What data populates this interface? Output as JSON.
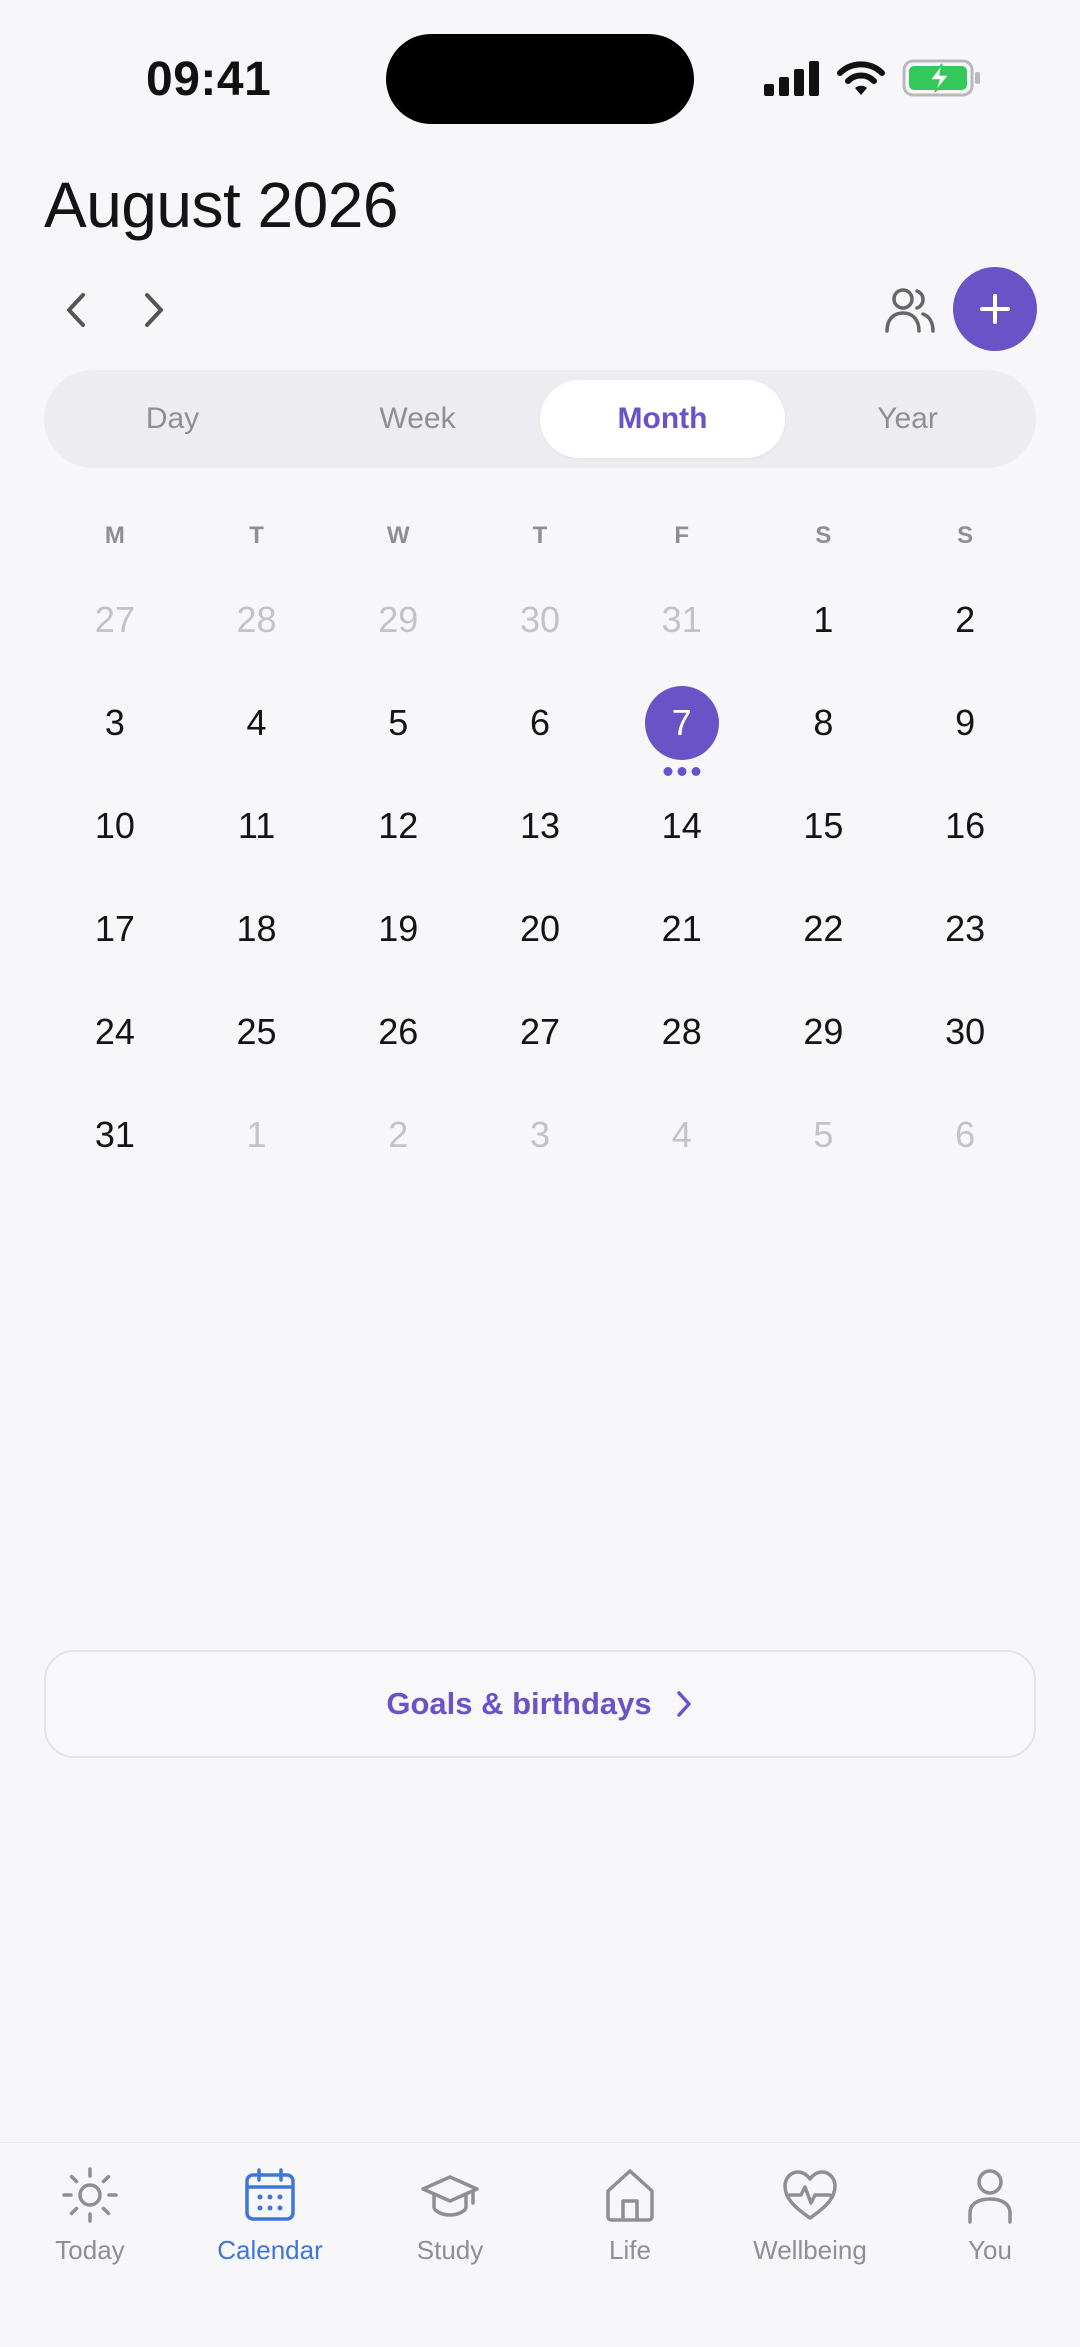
{
  "status_bar": {
    "time": "09:41"
  },
  "header": {
    "title": "August 2026"
  },
  "icons": {
    "prev": "chevron-left-icon",
    "next": "chevron-right-icon",
    "people": "people-icon",
    "add": "plus-icon"
  },
  "view_tabs": [
    {
      "label": "Day",
      "active": false
    },
    {
      "label": "Week",
      "active": false
    },
    {
      "label": "Month",
      "active": true
    },
    {
      "label": "Year",
      "active": false
    }
  ],
  "weekdays": [
    "M",
    "T",
    "W",
    "T",
    "F",
    "S",
    "S"
  ],
  "days": [
    {
      "n": "27",
      "muted": true
    },
    {
      "n": "28",
      "muted": true
    },
    {
      "n": "29",
      "muted": true
    },
    {
      "n": "30",
      "muted": true
    },
    {
      "n": "31",
      "muted": true
    },
    {
      "n": "1"
    },
    {
      "n": "2"
    },
    {
      "n": "3"
    },
    {
      "n": "4"
    },
    {
      "n": "5"
    },
    {
      "n": "6"
    },
    {
      "n": "7",
      "today": true,
      "events": 3
    },
    {
      "n": "8"
    },
    {
      "n": "9"
    },
    {
      "n": "10"
    },
    {
      "n": "11"
    },
    {
      "n": "12"
    },
    {
      "n": "13"
    },
    {
      "n": "14"
    },
    {
      "n": "15"
    },
    {
      "n": "16"
    },
    {
      "n": "17"
    },
    {
      "n": "18"
    },
    {
      "n": "19"
    },
    {
      "n": "20"
    },
    {
      "n": "21"
    },
    {
      "n": "22"
    },
    {
      "n": "23"
    },
    {
      "n": "24"
    },
    {
      "n": "25"
    },
    {
      "n": "26"
    },
    {
      "n": "27"
    },
    {
      "n": "28"
    },
    {
      "n": "29"
    },
    {
      "n": "30"
    },
    {
      "n": "31"
    },
    {
      "n": "1",
      "muted": true
    },
    {
      "n": "2",
      "muted": true
    },
    {
      "n": "3",
      "muted": true
    },
    {
      "n": "4",
      "muted": true
    },
    {
      "n": "5",
      "muted": true
    },
    {
      "n": "6",
      "muted": true
    }
  ],
  "goals_button": {
    "label": "Goals & birthdays"
  },
  "tabbar": [
    {
      "label": "Today",
      "icon": "sun-icon",
      "active": false
    },
    {
      "label": "Calendar",
      "icon": "calendar-icon",
      "active": true
    },
    {
      "label": "Study",
      "icon": "graduation-cap-icon",
      "active": false
    },
    {
      "label": "Life",
      "icon": "home-icon",
      "active": false
    },
    {
      "label": "Wellbeing",
      "icon": "heart-pulse-icon",
      "active": false
    },
    {
      "label": "You",
      "icon": "person-icon",
      "active": false
    }
  ],
  "colors": {
    "accent": "#6A52C7",
    "tab_active": "#3F76D9",
    "muted_text": "#8E8E94",
    "background": "#F7F7FA",
    "battery": "#34C759"
  }
}
